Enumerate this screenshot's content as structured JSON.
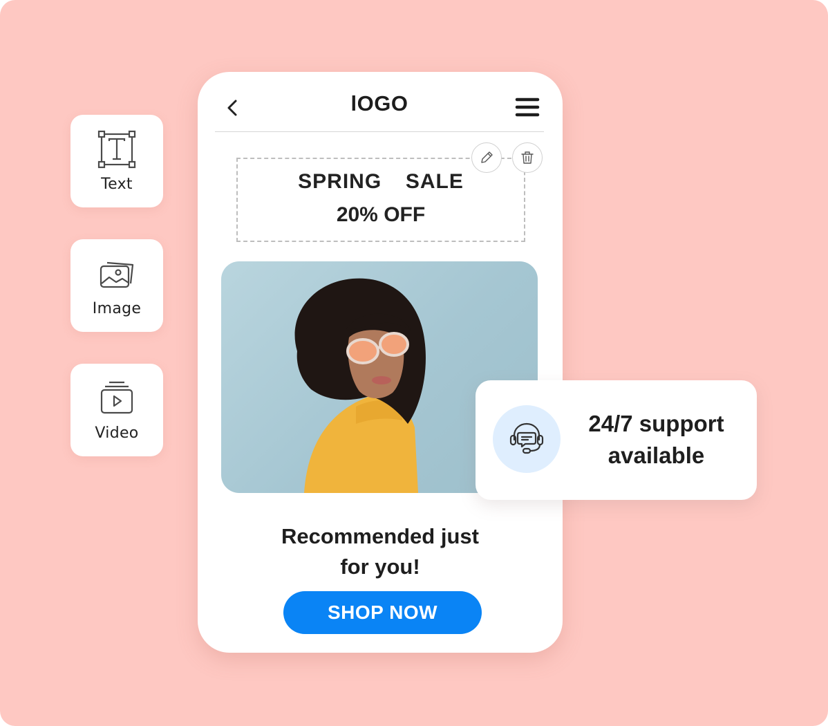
{
  "tools": [
    {
      "label": "Text",
      "icon": "text-box-icon"
    },
    {
      "label": "Image",
      "icon": "image-icon"
    },
    {
      "label": "Video",
      "icon": "video-icon"
    }
  ],
  "phone": {
    "header": {
      "logo": "lOGO",
      "back_icon": "chevron-left-icon",
      "menu_icon": "hamburger-menu-icon"
    },
    "banner": {
      "line1": "SPRING  SALE",
      "line2": "20% OFF",
      "edit_icon": "pencil-icon",
      "delete_icon": "trash-icon"
    },
    "photo": {
      "alt": "Woman with curly hair wearing orange sunglasses and yellow sweater"
    },
    "recommendation": {
      "line1": "Recommended just",
      "line2": "for you!"
    },
    "cta": {
      "label": "SHOP NOW"
    }
  },
  "support": {
    "line1": "24/7 support",
    "line2": "available",
    "icon": "headset-chat-icon"
  },
  "colors": {
    "background": "#fec8c2",
    "cta": "#0a84f5",
    "support_icon_bg": "#dfeefe",
    "text": "#1e1e1e"
  }
}
